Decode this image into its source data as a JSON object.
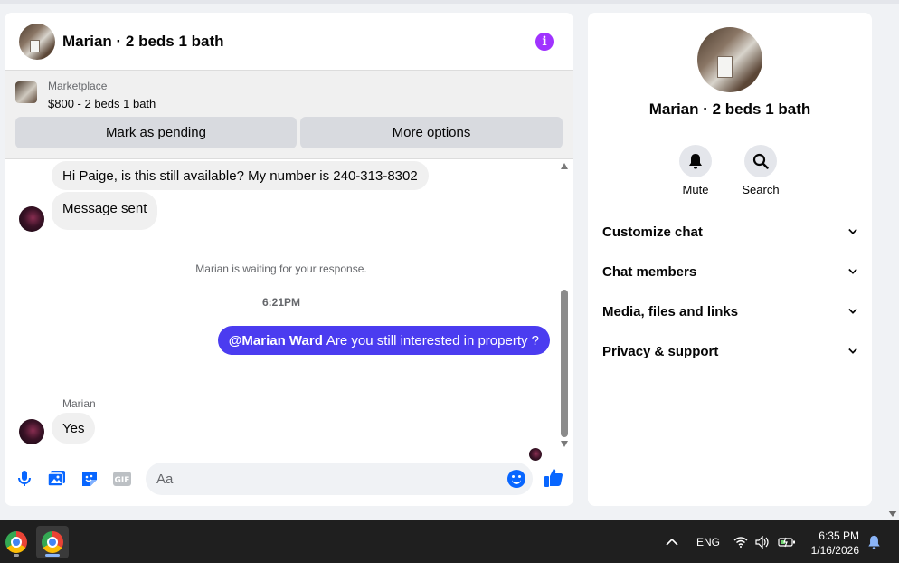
{
  "chat": {
    "title": "Marian · 2 beds 1 bath",
    "marketplace": {
      "label": "Marketplace",
      "price": "$800 - 2 beds 1 bath",
      "pending_label": "Mark as pending",
      "more_label": "More options"
    },
    "messages": {
      "in1": "Hi Paige, is this still available? My number is 240-313-8302",
      "in2": "Message sent",
      "waiting": "Marian is waiting for your response.",
      "time": "6:21PM",
      "out_mention": "@Marian Ward",
      "out_text": "Are you still interested in property ?",
      "sender": "Marian",
      "in3": "Yes"
    },
    "composer": {
      "placeholder": "Aa"
    }
  },
  "side": {
    "title": "Marian · 2 beds 1 bath",
    "mute_label": "Mute",
    "search_label": "Search",
    "sections": [
      "Customize chat",
      "Chat members",
      "Media, files and links",
      "Privacy & support"
    ]
  },
  "taskbar": {
    "lang": "ENG",
    "time": "6:35 PM",
    "date": "1/16/2026"
  },
  "colors": {
    "accent": "#4b3cf0",
    "messenger_blue": "#0866ff",
    "info_purple": "#a033ff"
  },
  "icons": [
    "info-icon",
    "microphone-icon",
    "image-icon",
    "sticker-icon",
    "gif-icon",
    "emoji-icon",
    "like-icon",
    "bell-icon",
    "search-icon",
    "chevron-down-icon",
    "chrome-icon",
    "wifi-icon",
    "volume-icon",
    "battery-icon",
    "notification-bell-icon",
    "chevron-up-icon"
  ]
}
